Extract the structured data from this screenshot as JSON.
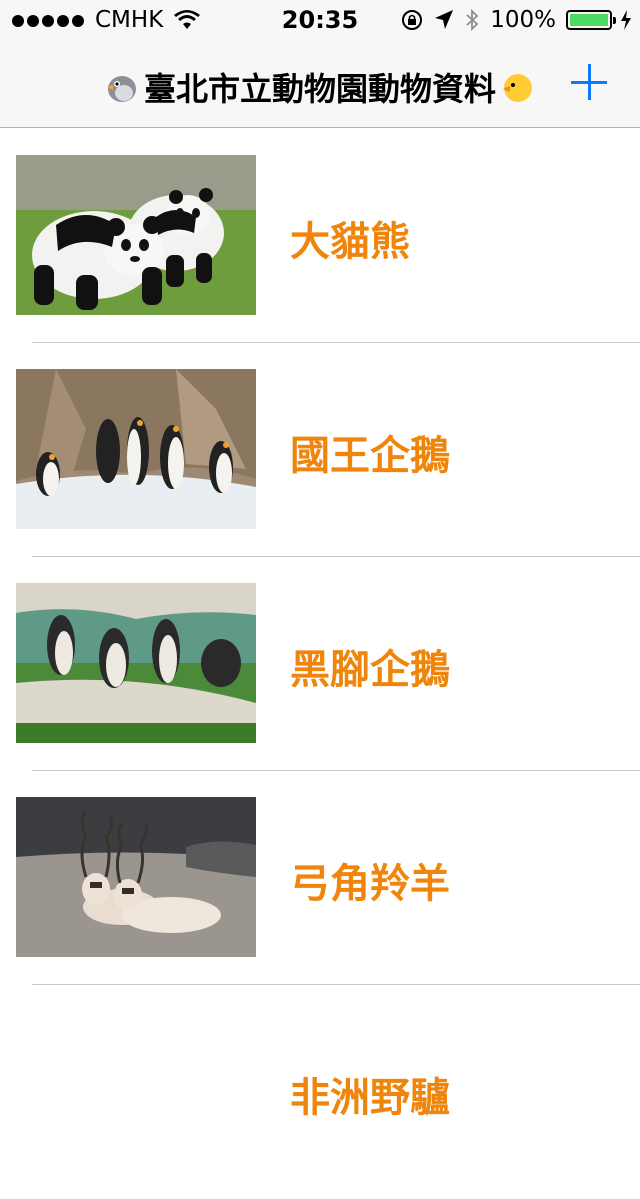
{
  "status_bar": {
    "carrier": "CMHK",
    "time": "20:35",
    "battery_percent": "100%",
    "battery_level": 1.0,
    "icons": [
      "signal-dots-icon",
      "wifi-icon",
      "rotation-lock-icon",
      "location-arrow-icon",
      "bluetooth-icon",
      "battery-icon",
      "charging-bolt-icon"
    ]
  },
  "nav": {
    "title": "臺北市立動物園動物資料",
    "left_emoji": "bird-emoji-icon",
    "right_emoji": "chick-emoji-icon",
    "add_icon": "plus-icon",
    "accent_color": "#0a7aff"
  },
  "animals": [
    {
      "name": "大貓熊",
      "image": "pandas-photo"
    },
    {
      "name": "國王企鵝",
      "image": "king-penguins-photo"
    },
    {
      "name": "黑腳企鵝",
      "image": "african-penguins-photo"
    },
    {
      "name": "弓角羚羊",
      "image": "addax-antelope-photo"
    },
    {
      "name": "非洲野驢",
      "image": ""
    }
  ],
  "name_color": "#f0850c"
}
